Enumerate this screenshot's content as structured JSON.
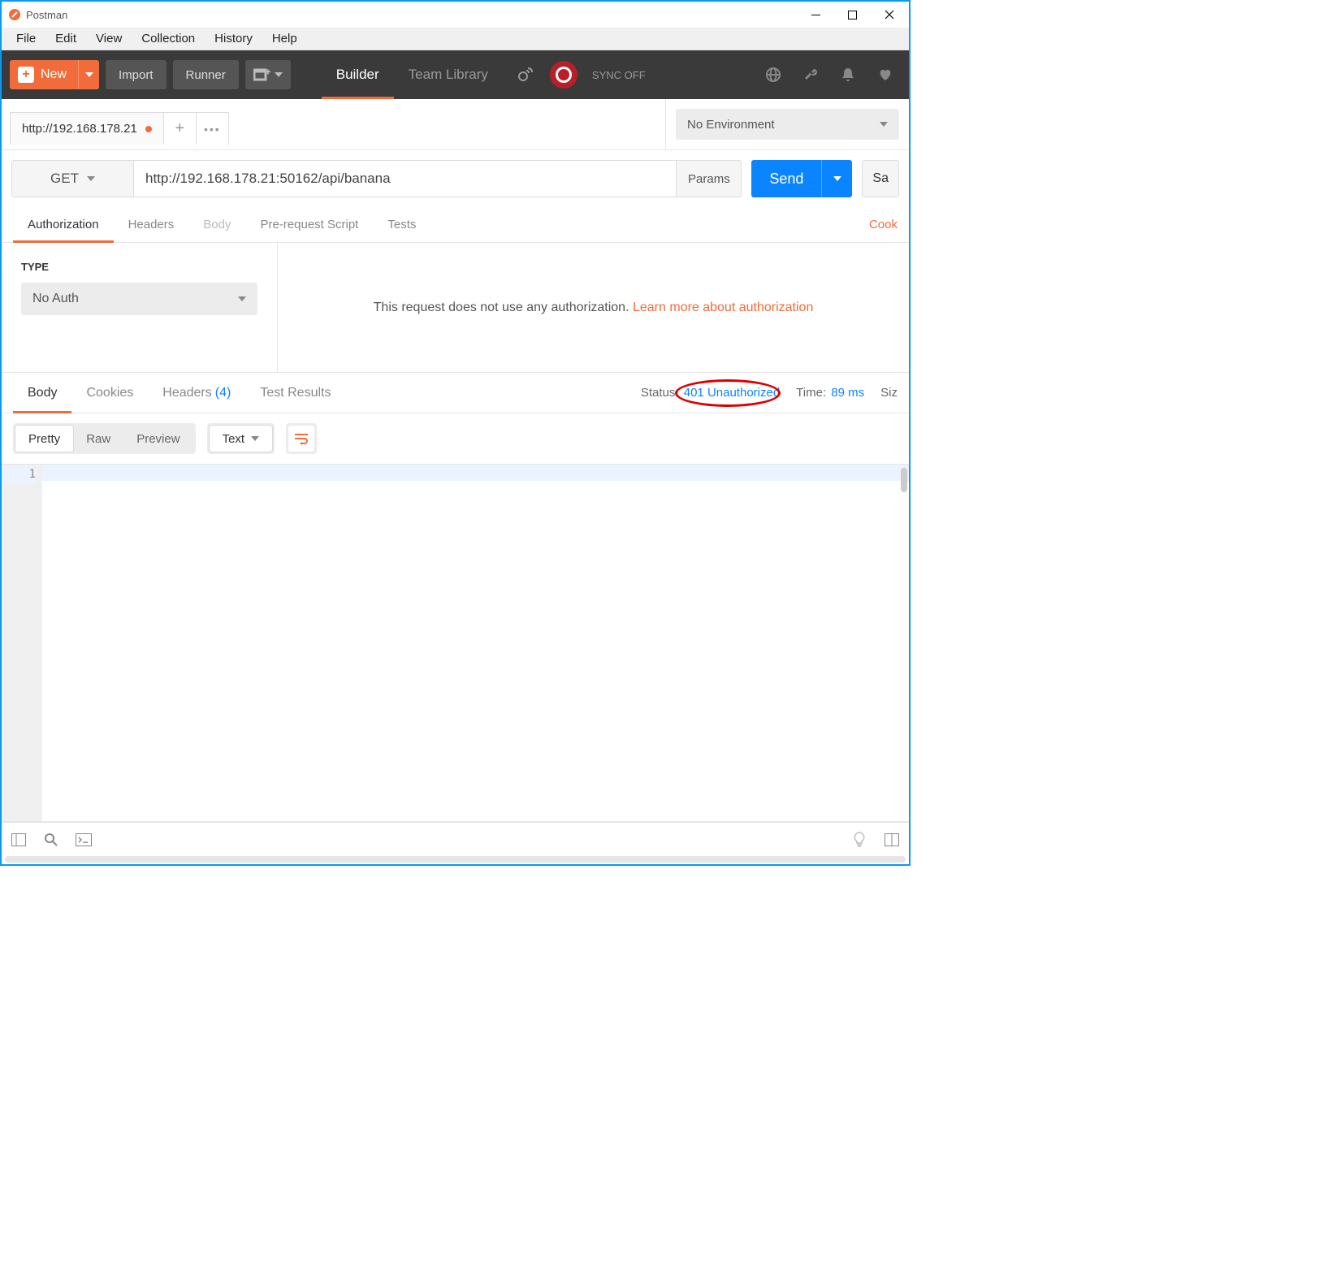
{
  "title": "Postman",
  "menu": [
    "File",
    "Edit",
    "View",
    "Collection",
    "History",
    "Help"
  ],
  "toolbar": {
    "new_label": "New",
    "import_label": "Import",
    "runner_label": "Runner",
    "builder_tab": "Builder",
    "team_library_tab": "Team Library",
    "sync_label": "SYNC OFF"
  },
  "request_tabs": {
    "active_label": "http://192.168.178.21"
  },
  "environment": {
    "selected": "No Environment"
  },
  "request": {
    "method": "GET",
    "url": "http://192.168.178.21:50162/api/banana",
    "params_label": "Params",
    "send_label": "Send",
    "save_label": "Sa"
  },
  "req_subtabs": {
    "authorization": "Authorization",
    "headers": "Headers",
    "body": "Body",
    "prerequest": "Pre-request Script",
    "tests": "Tests",
    "cookies_link": "Cook"
  },
  "auth": {
    "type_label": "TYPE",
    "selected": "No Auth",
    "info_text": "This request does not use any authorization. ",
    "info_link": "Learn more about authorization"
  },
  "resp_subtabs": {
    "body": "Body",
    "cookies": "Cookies",
    "headers": "Headers",
    "headers_count": "(4)",
    "tests": "Test Results"
  },
  "resp_meta": {
    "status_label": "Status:",
    "status_value": "401 Unauthorized",
    "time_label": "Time:",
    "time_value": "89 ms",
    "size_label": "Siz"
  },
  "view_modes": {
    "pretty": "Pretty",
    "raw": "Raw",
    "preview": "Preview",
    "lang": "Text"
  },
  "code": {
    "line_number": "1"
  }
}
